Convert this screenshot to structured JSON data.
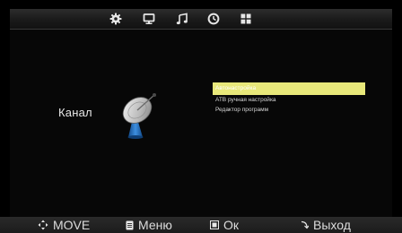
{
  "topbar": {
    "tabs": [
      {
        "icon": "gear-icon"
      },
      {
        "icon": "monitor-icon"
      },
      {
        "icon": "music-note-icon"
      },
      {
        "icon": "clock-icon"
      },
      {
        "icon": "grid-icon"
      }
    ]
  },
  "section": {
    "title": "Канал",
    "icon": "satellite-dish-icon"
  },
  "menu": {
    "items": [
      {
        "label": "Автонастройка",
        "selected": true
      },
      {
        "label": "АТВ ручная настройка",
        "selected": false
      },
      {
        "label": "Редактор программ",
        "selected": false
      }
    ]
  },
  "hints": {
    "move": "MOVE",
    "menu": "Меню",
    "ok": "Ок",
    "exit": "Выход"
  },
  "colors": {
    "highlight": "#e8e87a",
    "background": "#000000",
    "accent_blue": "#2a7fd4"
  }
}
